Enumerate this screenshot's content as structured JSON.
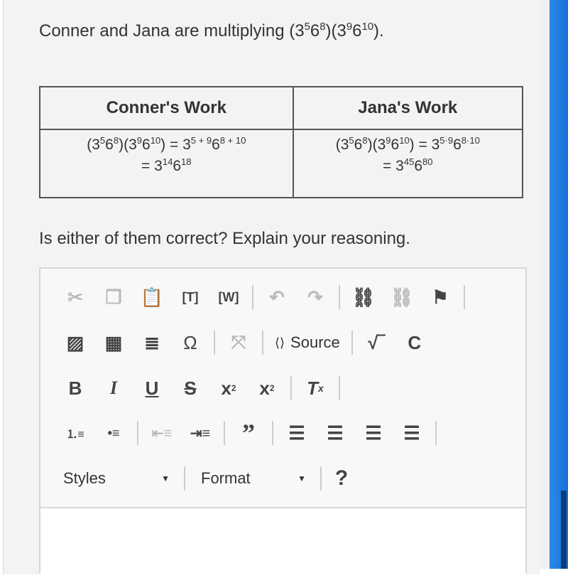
{
  "question": {
    "text": "Conner and Jana are multiplying ",
    "expr": [
      "(3",
      "5",
      "6",
      "8",
      ")(3",
      "9",
      "6",
      "10",
      ")."
    ]
  },
  "table": {
    "headers": [
      "Conner's Work",
      "Jana's Work"
    ],
    "conner": {
      "line1": [
        "(3",
        "5",
        "6",
        "8",
        ")(3",
        "9",
        "6",
        "10",
        ") = 3",
        "5 + 9",
        "6",
        "8 + 10"
      ],
      "line2": [
        "= 3",
        "14",
        "6",
        "18"
      ]
    },
    "jana": {
      "line1": [
        "(3",
        "5",
        "6",
        "8",
        ")(3",
        "9",
        "6",
        "10",
        ") = 3",
        "5·9",
        "6",
        "8·10"
      ],
      "line2": [
        "= 3",
        "45",
        "6",
        "80"
      ]
    }
  },
  "prompt": "Is either of them correct? Explain your reasoning.",
  "toolbar": {
    "source_label": "Source",
    "styles_label": "Styles",
    "format_label": "Format",
    "help_label": "?"
  },
  "colors": {
    "scrollbar": "#1a6fd8",
    "page_bg": "#f3f3f3"
  }
}
